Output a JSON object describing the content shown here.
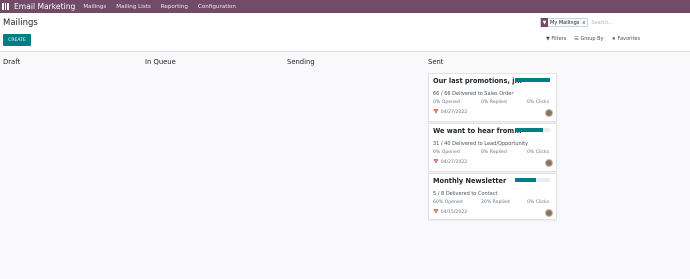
{
  "navbar": {
    "app_name": "Email Marketing",
    "menu": [
      "Mailings",
      "Mailing Lists",
      "Reporting",
      "Configuration"
    ]
  },
  "control_panel": {
    "title": "Mailings",
    "create_label": "CREATE",
    "search": {
      "facet_label": "My Mailings",
      "facet_remove": "x",
      "placeholder": "Search..."
    },
    "filters_label": "Filters",
    "group_by_label": "Group By",
    "favorites_label": "Favorites"
  },
  "kanban": {
    "columns": [
      "Draft",
      "In Queue",
      "Sending",
      "Sent"
    ],
    "cards": [
      {
        "title": "Our last promotions, j...",
        "progress": 1.0,
        "delivered": "66 / 66 Delivered to Sales Order",
        "opened": "0% Opened",
        "replied": "0% Replied",
        "clicks": "0% Clicks",
        "date": "04/27/2022"
      },
      {
        "title": "We want to hear from...",
        "progress": 0.8,
        "delivered": "31 / 40 Delivered to Lead/Opportunity",
        "opened": "0% Opened",
        "replied": "0% Replied",
        "clicks": "0% Clicks",
        "date": "04/27/2022"
      },
      {
        "title": "Monthly Newsletter",
        "progress": 0.6,
        "delivered": "5 / 8 Delivered to Contact",
        "opened": "60% Opened",
        "replied": "20% Replied",
        "clicks": "0% Clicks",
        "date": "04/15/2022"
      }
    ]
  },
  "colors": {
    "navbar": "#714b67",
    "primary": "#017e84"
  }
}
